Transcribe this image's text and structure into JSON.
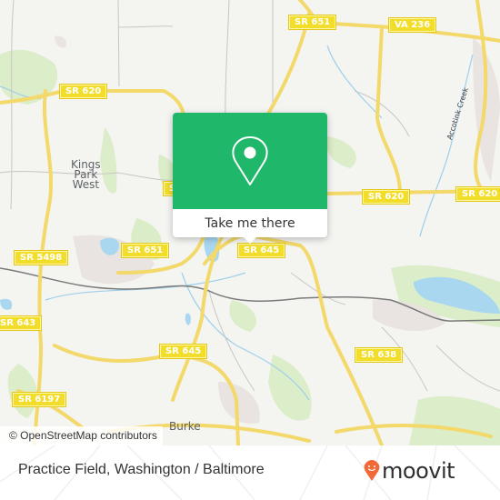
{
  "map": {
    "road_labels": [
      {
        "id": "sr651-top",
        "text": "SR 651"
      },
      {
        "id": "va236",
        "text": "VA 236"
      },
      {
        "id": "sr620-left",
        "text": "SR 620"
      },
      {
        "id": "sr620-mid",
        "text": "SR 620"
      },
      {
        "id": "sr620-right",
        "text": "SR 620"
      },
      {
        "id": "sr5498",
        "text": "SR 5498"
      },
      {
        "id": "sr651-mid",
        "text": "SR 651"
      },
      {
        "id": "sr645-top",
        "text": "SR 645"
      },
      {
        "id": "sr643",
        "text": "SR 643"
      },
      {
        "id": "sr645-bottom",
        "text": "SR 645"
      },
      {
        "id": "sr638",
        "text": "SR 638"
      },
      {
        "id": "sr6197",
        "text": "SR 6197"
      },
      {
        "id": "sr-partial",
        "text": "S"
      }
    ],
    "place_labels": {
      "kings_park_west": "Kings\nPark\nWest",
      "burke": "Burke",
      "accotink_creek": "Accotink Creek"
    },
    "attribution": "© OpenStreetMap contributors"
  },
  "popup": {
    "icon": "location-pin-icon",
    "button_label": "Take me there"
  },
  "footer": {
    "title": "Practice Field, Washington / Baltimore",
    "brand": "moovit",
    "brand_color": "#f26836",
    "accent_color": "#1fb86a"
  }
}
